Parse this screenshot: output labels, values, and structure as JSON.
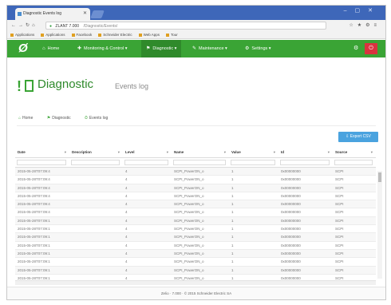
{
  "browser": {
    "tab_title": "Diagnostic Events log",
    "address_host": "ZLANT 7.000",
    "address_path": "/Diagnostic/Events/",
    "bookmarks": [
      "Applications",
      "Applications",
      "Facebook",
      "Schneider Electric",
      "Web Apps",
      "Tour"
    ]
  },
  "nav": {
    "logo": "Ø",
    "items": [
      {
        "label": "Home",
        "icon": "⌂"
      },
      {
        "label": "Monitoring & Control",
        "icon": "✚"
      },
      {
        "label": "Diagnostic",
        "icon": "⚑"
      },
      {
        "label": "Maintenance",
        "icon": "✎"
      },
      {
        "label": "Settings",
        "icon": "⚙"
      }
    ],
    "gear_icon": "gear-icon",
    "logout_icon": "power-icon"
  },
  "page": {
    "title": "Diagnostic",
    "subtitle": "Events log"
  },
  "breadcrumb": [
    {
      "label": "Home",
      "icon": "⌂"
    },
    {
      "label": "Diagnostic",
      "icon": "⚑"
    },
    {
      "label": "Events log",
      "icon": "⏱"
    }
  ],
  "export_label": "Export CSV",
  "table": {
    "columns": [
      "Date",
      "Description",
      "Level",
      "Name",
      "Value",
      "Id",
      "Source"
    ],
    "rows": [
      [
        "2015-05-28T07:09:4",
        "",
        "4",
        "SCPI_PowerON_o",
        "1",
        "0x00000000",
        "SCPI"
      ],
      [
        "2015-05-28T07:09:4",
        "",
        "4",
        "SCPI_PowerON_o",
        "1",
        "0x00000000",
        "SCPI"
      ],
      [
        "2015-05-28T07:09:4",
        "",
        "4",
        "SCPI_PowerON_o",
        "1",
        "0x00000000",
        "SCPI"
      ],
      [
        "2015-05-28T07:09:4",
        "",
        "4",
        "SCPI_PowerON_o",
        "1",
        "0x00000000",
        "SCPI"
      ],
      [
        "2015-05-28T07:09:4",
        "",
        "4",
        "SCPI_PowerON_o",
        "1",
        "0x00000000",
        "SCPI"
      ],
      [
        "2015-05-28T07:09:4",
        "",
        "4",
        "SCPI_PowerON_o",
        "1",
        "0x00000000",
        "SCPI"
      ],
      [
        "2015-05-28T07:09:1",
        "",
        "4",
        "SCPI_PowerON_o",
        "1",
        "0x00000000",
        "SCPI"
      ],
      [
        "2015-05-28T07:09:1",
        "",
        "4",
        "SCPI_PowerON_o",
        "1",
        "0x00000000",
        "SCPI"
      ],
      [
        "2015-05-28T07:09:1",
        "",
        "4",
        "SCPI_PowerON_o",
        "1",
        "0x00000000",
        "SCPI"
      ],
      [
        "2015-05-28T07:09:1",
        "",
        "4",
        "SCPI_PowerON_o",
        "1",
        "0x00000000",
        "SCPI"
      ],
      [
        "2015-05-28T07:09:1",
        "",
        "4",
        "SCPI_PowerON_o",
        "1",
        "0x00000000",
        "SCPI"
      ],
      [
        "2015-05-28T07:09:1",
        "",
        "4",
        "SCPI_PowerON_o",
        "1",
        "0x00000000",
        "SCPI"
      ],
      [
        "2015-05-28T07:09:1",
        "",
        "4",
        "SCPI_PowerON_o",
        "1",
        "0x00000000",
        "SCPI"
      ],
      [
        "2015-05-28T07:09:1",
        "",
        "4",
        "SCPI_PowerON_o",
        "1",
        "0x00000000",
        "SCPI"
      ]
    ]
  },
  "footer": "Zelio · 7.000 · © 2015 Schneider Electric SA"
}
